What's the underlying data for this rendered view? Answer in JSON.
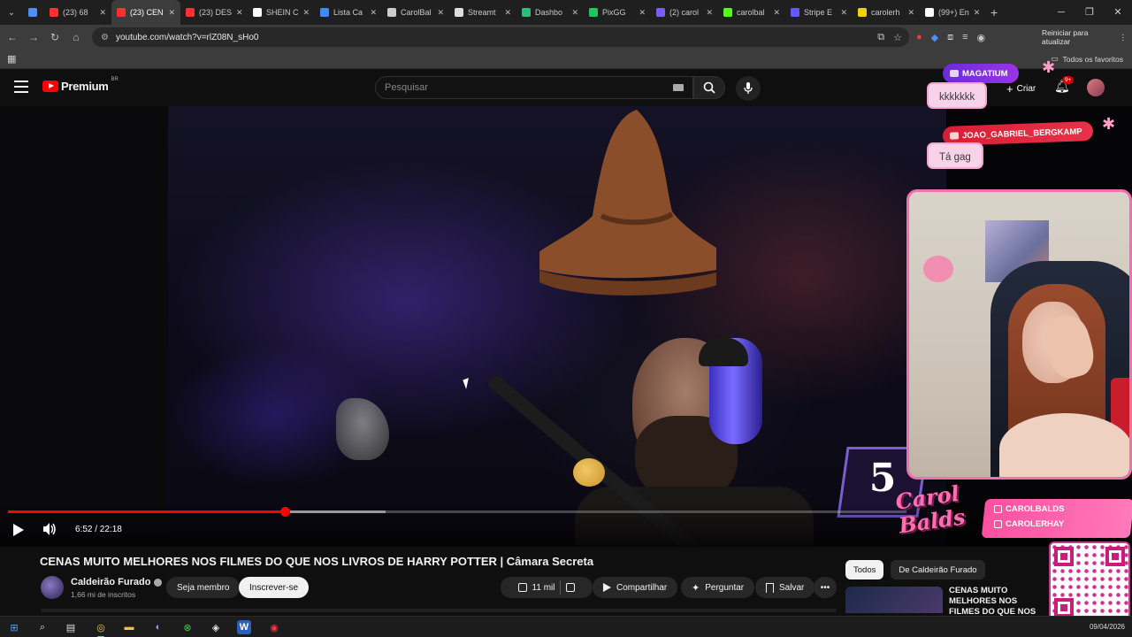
{
  "browser": {
    "tabs": [
      {
        "label": "",
        "color": "#4f8ef7",
        "active": false
      },
      {
        "label": "(23) 68",
        "color": "#ff3030",
        "active": false
      },
      {
        "label": "(23) CEN",
        "color": "#ff3030",
        "active": true
      },
      {
        "label": "(23) DES",
        "color": "#ff3030",
        "active": false
      },
      {
        "label": "SHEIN C",
        "color": "#ffffff",
        "active": false
      },
      {
        "label": "Lista Ca",
        "color": "#3d8bfd",
        "active": false
      },
      {
        "label": "CarolBal",
        "color": "#cccccc",
        "active": false
      },
      {
        "label": "Streamt",
        "color": "#dddddd",
        "active": false
      },
      {
        "label": "Dashbo",
        "color": "#2bbf7b",
        "active": false
      },
      {
        "label": "PixGG",
        "color": "#22c55e",
        "active": false
      },
      {
        "label": "(2) carol",
        "color": "#7c5cff",
        "active": false
      },
      {
        "label": "carolbal",
        "color": "#53fc18",
        "active": false
      },
      {
        "label": "Stripe E",
        "color": "#635bff",
        "active": false
      },
      {
        "label": "carolerh",
        "color": "#f5d000",
        "active": false
      },
      {
        "label": "(99+) En",
        "color": "#ffffff",
        "active": false
      }
    ],
    "url": "youtube.com/watch?v=rlZ08N_sHo0",
    "restart_label": "Reiniciar para atualizar",
    "all_bookmarks": "Todos os favoritos"
  },
  "youtube": {
    "logo_word": "Premium",
    "logo_country": "BR",
    "search_placeholder": "Pesquisar",
    "create_label": "Criar",
    "notif_count": "9+"
  },
  "player": {
    "time": "6:52 / 22:18",
    "played_fraction": 0.308,
    "buffered_fraction": 0.42
  },
  "overlay": {
    "chat": [
      {
        "user": "MAGATIUM",
        "message": "kkkkkkk"
      },
      {
        "user": "JOAO_GABRIEL_BERGKAMP",
        "message": "Tá gag"
      }
    ],
    "counter": "5",
    "brand_script": "Carol Balds",
    "handles": [
      "CAROLBALDS",
      "CAROLERHAY"
    ]
  },
  "video": {
    "title": "CENAS MUITO MELHORES NOS FILMES DO QUE NOS LIVROS DE HARRY POTTER | Câmara Secreta",
    "channel": "Caldeirão Furado",
    "subscribers": "1,66 mi de inscritos",
    "join_label": "Seja membro",
    "subscribe_label": "Inscrever-se",
    "likes": "11 mil",
    "share_label": "Compartilhar",
    "ask_label": "Perguntar",
    "save_label": "Salvar"
  },
  "recommendations": {
    "chips": [
      "Todos",
      "De Caldeirão Furado"
    ],
    "first_title": "CENAS MUITO MELHORES NOS FILMES DO QUE NOS LIVROS"
  },
  "taskbar": {
    "date": "09/04/2026"
  }
}
